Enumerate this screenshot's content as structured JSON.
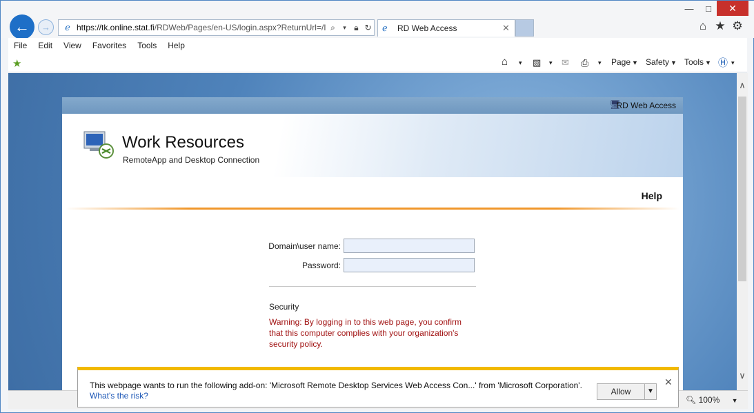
{
  "window": {
    "minimize_icon": "minimize-icon",
    "maximize_icon": "maximize-icon",
    "close_icon": "close-icon"
  },
  "address": {
    "url_host": "https://tk.online.stat.fi",
    "url_path": "/RDWeb/Pages/en-US/login.aspx?ReturnUrl=/I"
  },
  "tab": {
    "title": "RD Web Access"
  },
  "menu": [
    "File",
    "Edit",
    "View",
    "Favorites",
    "Tools",
    "Help"
  ],
  "commandbar": {
    "page": "Page",
    "safety": "Safety",
    "tools": "Tools"
  },
  "rd": {
    "strip_label": "RD Web Access",
    "title": "Work Resources",
    "subtitle": "RemoteApp and Desktop Connection",
    "help": "Help",
    "user_label": "Domain\\user name:",
    "user_value": "",
    "password_label": "Password:",
    "password_value": "",
    "security_heading": "Security",
    "security_text": "Warning: By logging in to this web page, you confirm that this computer complies with your organization's security policy."
  },
  "notification": {
    "text": "This webpage wants to run the following add-on: 'Microsoft Remote Desktop Services Web Access Con...' from 'Microsoft Corporation'.",
    "link": "What's the risk?",
    "allow": "Allow"
  },
  "status": {
    "zoom": "100%"
  },
  "colors": {
    "accent": "#1e6fc7",
    "warning_text": "#a01010",
    "notification_bar": "#f2b900",
    "divider": "#f0962a"
  }
}
